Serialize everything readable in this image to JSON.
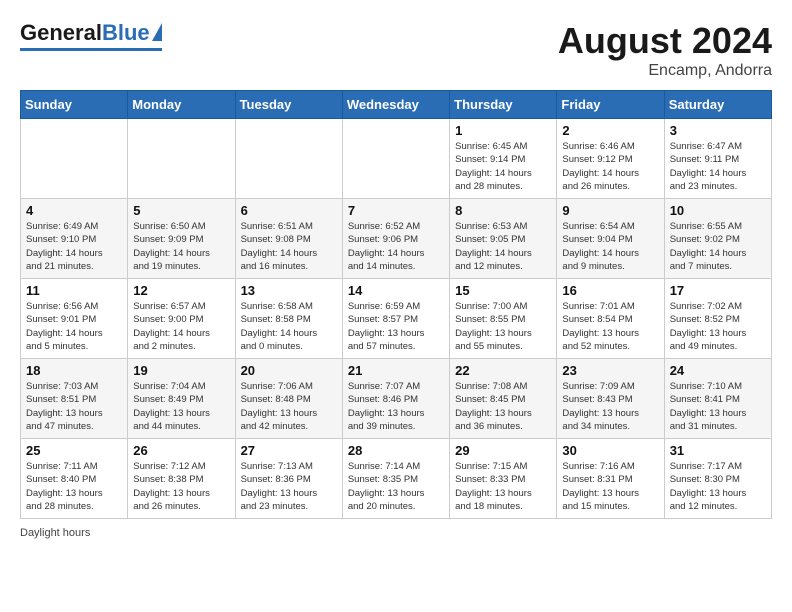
{
  "header": {
    "logo_general": "General",
    "logo_blue": "Blue",
    "month_year": "August 2024",
    "location": "Encamp, Andorra"
  },
  "footer": {
    "daylight_label": "Daylight hours"
  },
  "columns": [
    "Sunday",
    "Monday",
    "Tuesday",
    "Wednesday",
    "Thursday",
    "Friday",
    "Saturday"
  ],
  "weeks": [
    [
      {
        "day": "",
        "info": ""
      },
      {
        "day": "",
        "info": ""
      },
      {
        "day": "",
        "info": ""
      },
      {
        "day": "",
        "info": ""
      },
      {
        "day": "1",
        "info": "Sunrise: 6:45 AM\nSunset: 9:14 PM\nDaylight: 14 hours\nand 28 minutes."
      },
      {
        "day": "2",
        "info": "Sunrise: 6:46 AM\nSunset: 9:12 PM\nDaylight: 14 hours\nand 26 minutes."
      },
      {
        "day": "3",
        "info": "Sunrise: 6:47 AM\nSunset: 9:11 PM\nDaylight: 14 hours\nand 23 minutes."
      }
    ],
    [
      {
        "day": "4",
        "info": "Sunrise: 6:49 AM\nSunset: 9:10 PM\nDaylight: 14 hours\nand 21 minutes."
      },
      {
        "day": "5",
        "info": "Sunrise: 6:50 AM\nSunset: 9:09 PM\nDaylight: 14 hours\nand 19 minutes."
      },
      {
        "day": "6",
        "info": "Sunrise: 6:51 AM\nSunset: 9:08 PM\nDaylight: 14 hours\nand 16 minutes."
      },
      {
        "day": "7",
        "info": "Sunrise: 6:52 AM\nSunset: 9:06 PM\nDaylight: 14 hours\nand 14 minutes."
      },
      {
        "day": "8",
        "info": "Sunrise: 6:53 AM\nSunset: 9:05 PM\nDaylight: 14 hours\nand 12 minutes."
      },
      {
        "day": "9",
        "info": "Sunrise: 6:54 AM\nSunset: 9:04 PM\nDaylight: 14 hours\nand 9 minutes."
      },
      {
        "day": "10",
        "info": "Sunrise: 6:55 AM\nSunset: 9:02 PM\nDaylight: 14 hours\nand 7 minutes."
      }
    ],
    [
      {
        "day": "11",
        "info": "Sunrise: 6:56 AM\nSunset: 9:01 PM\nDaylight: 14 hours\nand 5 minutes."
      },
      {
        "day": "12",
        "info": "Sunrise: 6:57 AM\nSunset: 9:00 PM\nDaylight: 14 hours\nand 2 minutes."
      },
      {
        "day": "13",
        "info": "Sunrise: 6:58 AM\nSunset: 8:58 PM\nDaylight: 14 hours\nand 0 minutes."
      },
      {
        "day": "14",
        "info": "Sunrise: 6:59 AM\nSunset: 8:57 PM\nDaylight: 13 hours\nand 57 minutes."
      },
      {
        "day": "15",
        "info": "Sunrise: 7:00 AM\nSunset: 8:55 PM\nDaylight: 13 hours\nand 55 minutes."
      },
      {
        "day": "16",
        "info": "Sunrise: 7:01 AM\nSunset: 8:54 PM\nDaylight: 13 hours\nand 52 minutes."
      },
      {
        "day": "17",
        "info": "Sunrise: 7:02 AM\nSunset: 8:52 PM\nDaylight: 13 hours\nand 49 minutes."
      }
    ],
    [
      {
        "day": "18",
        "info": "Sunrise: 7:03 AM\nSunset: 8:51 PM\nDaylight: 13 hours\nand 47 minutes."
      },
      {
        "day": "19",
        "info": "Sunrise: 7:04 AM\nSunset: 8:49 PM\nDaylight: 13 hours\nand 44 minutes."
      },
      {
        "day": "20",
        "info": "Sunrise: 7:06 AM\nSunset: 8:48 PM\nDaylight: 13 hours\nand 42 minutes."
      },
      {
        "day": "21",
        "info": "Sunrise: 7:07 AM\nSunset: 8:46 PM\nDaylight: 13 hours\nand 39 minutes."
      },
      {
        "day": "22",
        "info": "Sunrise: 7:08 AM\nSunset: 8:45 PM\nDaylight: 13 hours\nand 36 minutes."
      },
      {
        "day": "23",
        "info": "Sunrise: 7:09 AM\nSunset: 8:43 PM\nDaylight: 13 hours\nand 34 minutes."
      },
      {
        "day": "24",
        "info": "Sunrise: 7:10 AM\nSunset: 8:41 PM\nDaylight: 13 hours\nand 31 minutes."
      }
    ],
    [
      {
        "day": "25",
        "info": "Sunrise: 7:11 AM\nSunset: 8:40 PM\nDaylight: 13 hours\nand 28 minutes."
      },
      {
        "day": "26",
        "info": "Sunrise: 7:12 AM\nSunset: 8:38 PM\nDaylight: 13 hours\nand 26 minutes."
      },
      {
        "day": "27",
        "info": "Sunrise: 7:13 AM\nSunset: 8:36 PM\nDaylight: 13 hours\nand 23 minutes."
      },
      {
        "day": "28",
        "info": "Sunrise: 7:14 AM\nSunset: 8:35 PM\nDaylight: 13 hours\nand 20 minutes."
      },
      {
        "day": "29",
        "info": "Sunrise: 7:15 AM\nSunset: 8:33 PM\nDaylight: 13 hours\nand 18 minutes."
      },
      {
        "day": "30",
        "info": "Sunrise: 7:16 AM\nSunset: 8:31 PM\nDaylight: 13 hours\nand 15 minutes."
      },
      {
        "day": "31",
        "info": "Sunrise: 7:17 AM\nSunset: 8:30 PM\nDaylight: 13 hours\nand 12 minutes."
      }
    ]
  ]
}
